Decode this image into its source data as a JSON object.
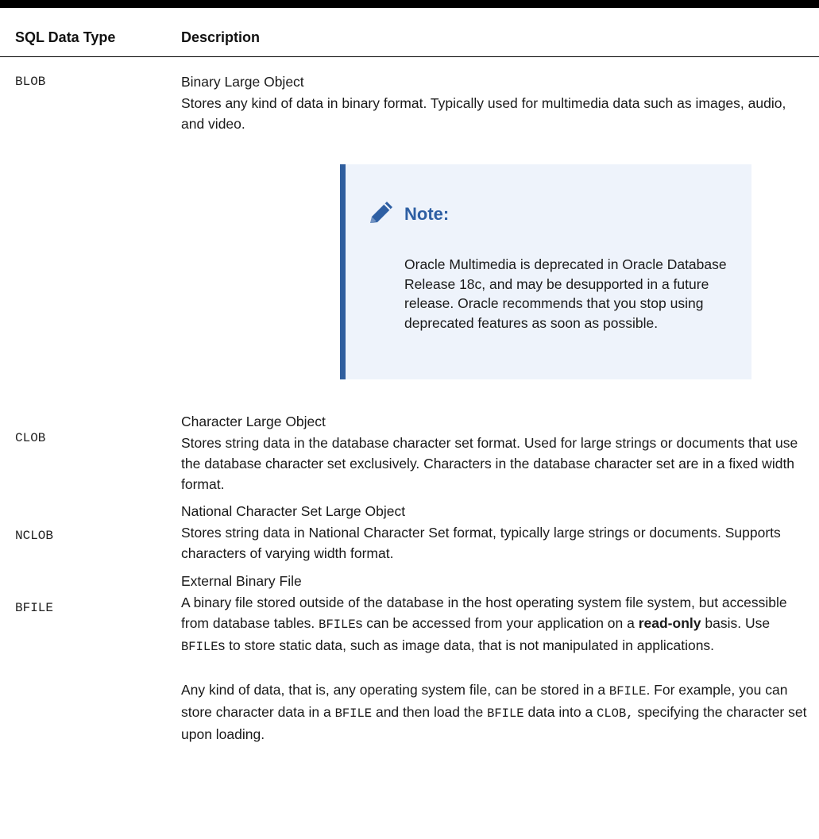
{
  "header": {
    "type_col": "SQL Data Type",
    "desc_col": "Description"
  },
  "rows": [
    {
      "type": "BLOB",
      "title": "Binary Large Object",
      "body": "Stores any kind of data in binary format. Typically used for multimedia data such as images, audio, and video."
    },
    {
      "type": "CLOB",
      "title": "Character Large Object",
      "body": "Stores string data in the database character set format. Used for large strings or documents that use the database character set exclusively. Characters in the database character set are in a fixed width format."
    },
    {
      "type": "NCLOB",
      "title": "National Character Set Large Object",
      "body": "Stores string data in National Character Set format, typically large strings or documents. Supports characters of varying width format."
    },
    {
      "type": "BFILE",
      "title": "External Binary File",
      "p1": {
        "a": "A binary file stored outside of the database in the host operating system file system, but accessible from database tables. ",
        "code1": "BFILE",
        "b": "s can be accessed from your application on a ",
        "bold": "read-only",
        "c": " basis. Use ",
        "code2": "BFILE",
        "d": "s to store static data, such as image data, that is not manipulated in applications."
      },
      "p2": {
        "a": "Any kind of data, that is, any operating system file, can be stored in a ",
        "code1": "BFILE",
        "b": ". For example, you can store character data in a ",
        "code2": "BFILE",
        "c": " and then load the ",
        "code3": "BFILE",
        "d": " data into a ",
        "code4": "CLOB,",
        "e": " specifying the character set upon loading."
      }
    }
  ],
  "note": {
    "icon": "pencil-icon",
    "title": "Note:",
    "body": "Oracle Multimedia is deprecated in Oracle Database Release 18c, and may be desupported in a future release. Oracle recommends that you stop using deprecated features as soon as possible.",
    "accent": "#2f5e9e",
    "title_color": "#2e5fa3",
    "background": "#eef3fb"
  }
}
